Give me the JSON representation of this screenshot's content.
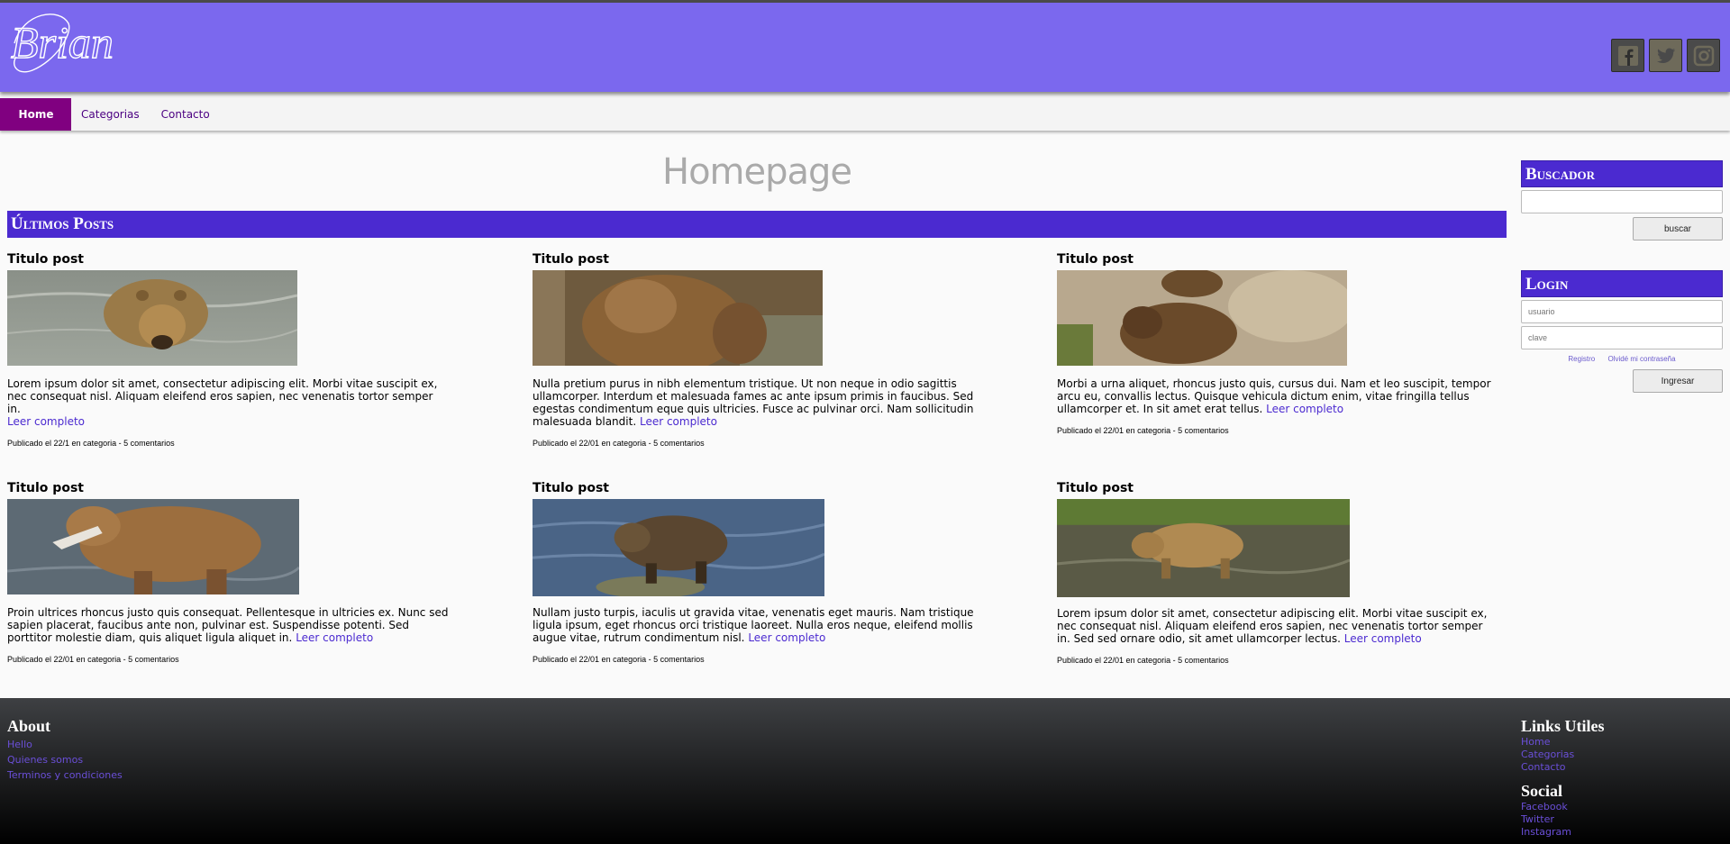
{
  "header": {
    "logo_text": "Brian",
    "social": [
      {
        "icon": "facebook-icon"
      },
      {
        "icon": "twitter-icon"
      },
      {
        "icon": "instagram-icon"
      }
    ]
  },
  "nav": {
    "items": [
      {
        "label": "Home",
        "active": true
      },
      {
        "label": "Categorias",
        "active": false
      },
      {
        "label": "Contacto",
        "active": false
      }
    ]
  },
  "main": {
    "page_title": "Homepage",
    "section_title": "Últimos Posts",
    "posts": [
      {
        "title": "Titulo post",
        "image": "bear-in-water",
        "text": "Lorem ipsum dolor sit amet, consectetur adipiscing elit. Morbi vitae suscipit ex, nec consequat nisl. Aliquam eleifend eros sapien, nec venenatis tortor semper in.",
        "read_more": "Leer completo",
        "meta": "Publicado el 22/1 en categoria - 5 comentarios"
      },
      {
        "title": "Titulo post",
        "image": "bear-sitting",
        "text": "Nulla pretium purus in nibh elementum tristique. Ut non neque in odio sagittis ullamcorper. Interdum et malesuada fames ac ante ipsum primis in faucibus. Sed egestas condimentum eque quis ultricies. Fusce ac pulvinar orci. Nam sollicitudin malesuada blandit.",
        "read_more": "Leer completo",
        "meta": "Publicado el 22/01 en categoria - 5 comentarios"
      },
      {
        "title": "Titulo post",
        "image": "bear-on-rocks",
        "text": "Morbi a urna aliquet, rhoncus justo quis, cursus dui. Nam et leo suscipit, tempor arcu eu, convallis lectus. Quisque vehicula dictum enim, vitae fringilla tellus ullamcorper et. In sit amet erat tellus.",
        "read_more": "Leer completo",
        "meta": "Publicado el 22/01 en categoria - 5 comentarios"
      },
      {
        "title": "Titulo post",
        "image": "bear-with-fish",
        "text": "Proin ultrices rhoncus justo quis consequat. Pellentesque in ultricies ex. Nunc sed sapien placerat, faucibus ante non, pulvinar est. Suspendisse potenti. Sed porttitor molestie diam, quis aliquet ligula aliquet in.",
        "read_more": "Leer completo",
        "meta": "Publicado el 22/01 en categoria - 5 comentarios"
      },
      {
        "title": "Titulo post",
        "image": "bear-on-rock-in-river",
        "text": "Nullam justo turpis, iaculis ut gravida vitae, venenatis eget mauris. Nam tristique ligula ipsum, eget rhoncus orci tristique laoreet. Nulla eros neque, eleifend mollis augue vitae, rutrum condimentum nisl.",
        "read_more": "Leer completo",
        "meta": "Publicado el 22/01 en categoria - 5 comentarios"
      },
      {
        "title": "Titulo post",
        "image": "bear-walking-in-stream",
        "text": "Lorem ipsum dolor sit amet, consectetur adipiscing elit. Morbi vitae suscipit ex, nec consequat nisl. Aliquam eleifend eros sapien, nec venenatis tortor semper in. Sed sed ornare odio, sit amet ullamcorper lectus.",
        "read_more": "Leer completo",
        "meta": "Publicado el 22/01 en categoria - 5 comentarios"
      }
    ]
  },
  "sidebar": {
    "search": {
      "title": "Buscador",
      "input_value": "",
      "button_label": "buscar"
    },
    "login": {
      "title": "Login",
      "user_placeholder": "usuario",
      "password_placeholder": "clave",
      "register_label": "Registro",
      "forgot_label": "Olvidé mi contraseña",
      "button_label": "Ingresar"
    }
  },
  "footer": {
    "about": {
      "title": "About",
      "links": [
        "Hello",
        "Quienes somos",
        "Terminos y condiciones"
      ]
    },
    "useful": {
      "title": "Links Utiles",
      "links": [
        "Home",
        "Categorias",
        "Contacto"
      ]
    },
    "social": {
      "title": "Social",
      "links": [
        "Facebook",
        "Twitter",
        "Instagram"
      ]
    }
  },
  "colors": {
    "header_bg": "#7b68ee",
    "accent": "#4b2ad0",
    "nav_active": "#800080",
    "link": "#4b2ad0"
  }
}
